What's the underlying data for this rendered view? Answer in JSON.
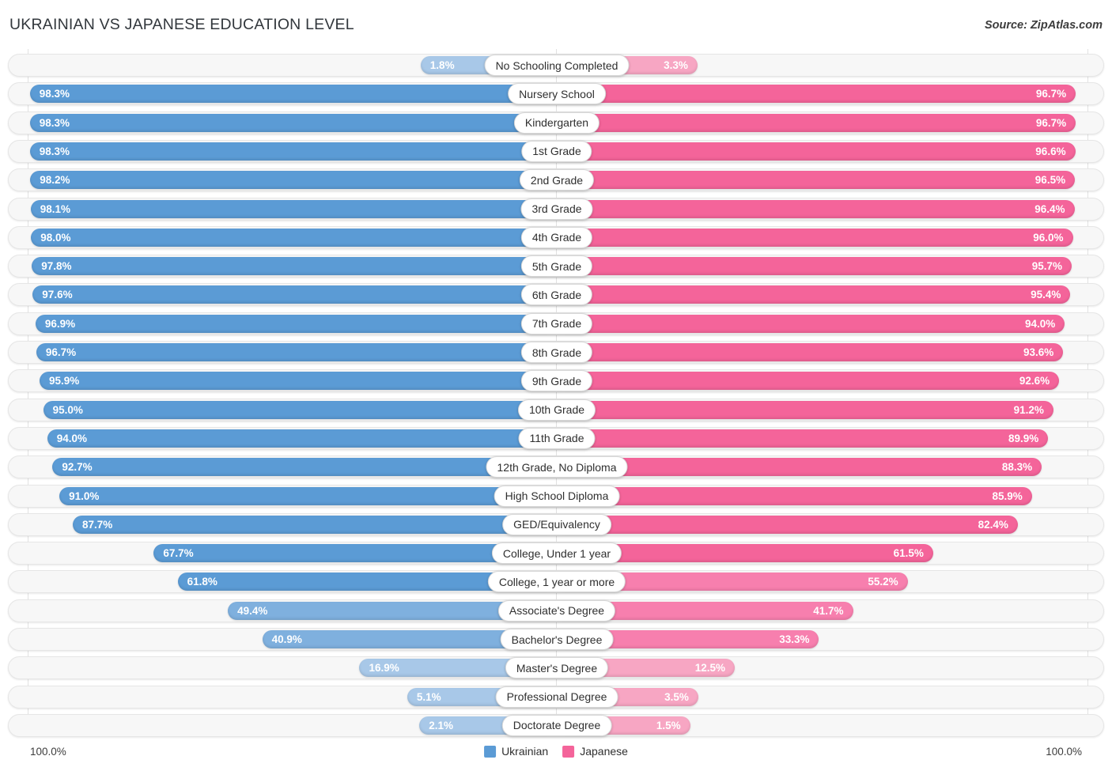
{
  "header": {
    "title": "UKRAINIAN VS JAPANESE EDUCATION LEVEL",
    "source": "Source: ZipAtlas.com"
  },
  "axis": {
    "left_max_label": "100.0%",
    "right_max_label": "100.0%"
  },
  "legend": {
    "items": [
      {
        "label": "Ukrainian",
        "color": "#5b9bd5"
      },
      {
        "label": "Japanese",
        "color": "#f4649a"
      }
    ]
  },
  "colors": {
    "ukrainian_strong": "#5b9bd5",
    "ukrainian_light": "#a8c8e8",
    "japanese_strong": "#f4649a",
    "japanese_light": "#f7a6c3",
    "row_track": "#f7f7f7",
    "gridline": "#e2e2e2"
  },
  "chart_data": {
    "type": "bar",
    "title": "UKRAINIAN VS JAPANESE EDUCATION LEVEL",
    "subtitle": "Source: ZipAtlas.com",
    "orientation": "horizontal-diverging",
    "xlabel": "",
    "ylabel": "",
    "xlim": [
      0,
      100
    ],
    "grid": true,
    "legend_position": "bottom-center",
    "unit": "%",
    "categories": [
      "No Schooling Completed",
      "Nursery School",
      "Kindergarten",
      "1st Grade",
      "2nd Grade",
      "3rd Grade",
      "4th Grade",
      "5th Grade",
      "6th Grade",
      "7th Grade",
      "8th Grade",
      "9th Grade",
      "10th Grade",
      "11th Grade",
      "12th Grade, No Diploma",
      "High School Diploma",
      "GED/Equivalency",
      "College, Under 1 year",
      "College, 1 year or more",
      "Associate's Degree",
      "Bachelor's Degree",
      "Master's Degree",
      "Professional Degree",
      "Doctorate Degree"
    ],
    "series": [
      {
        "name": "Ukrainian",
        "color": "#5b9bd5",
        "values": [
          1.8,
          98.3,
          98.3,
          98.3,
          98.2,
          98.1,
          98.0,
          97.8,
          97.6,
          96.9,
          96.7,
          95.9,
          95.0,
          94.0,
          92.7,
          91.0,
          87.7,
          67.7,
          61.8,
          49.4,
          40.9,
          16.9,
          5.1,
          2.1
        ],
        "labels": [
          "1.8%",
          "98.3%",
          "98.3%",
          "98.3%",
          "98.2%",
          "98.1%",
          "98.0%",
          "97.8%",
          "97.6%",
          "96.9%",
          "96.7%",
          "95.9%",
          "95.0%",
          "94.0%",
          "92.7%",
          "91.0%",
          "87.7%",
          "67.7%",
          "61.8%",
          "49.4%",
          "40.9%",
          "16.9%",
          "5.1%",
          "2.1%"
        ]
      },
      {
        "name": "Japanese",
        "color": "#f4649a",
        "values": [
          3.3,
          96.7,
          96.7,
          96.6,
          96.5,
          96.4,
          96.0,
          95.7,
          95.4,
          94.0,
          93.6,
          92.6,
          91.2,
          89.9,
          88.3,
          85.9,
          82.4,
          61.5,
          55.2,
          41.7,
          33.3,
          12.5,
          3.5,
          1.5
        ],
        "labels": [
          "3.3%",
          "96.7%",
          "96.7%",
          "96.6%",
          "96.5%",
          "96.4%",
          "96.0%",
          "95.7%",
          "95.4%",
          "94.0%",
          "93.6%",
          "92.6%",
          "91.2%",
          "89.9%",
          "88.3%",
          "85.9%",
          "82.4%",
          "61.5%",
          "55.2%",
          "41.7%",
          "33.3%",
          "12.5%",
          "3.5%",
          "1.5%"
        ]
      }
    ]
  }
}
